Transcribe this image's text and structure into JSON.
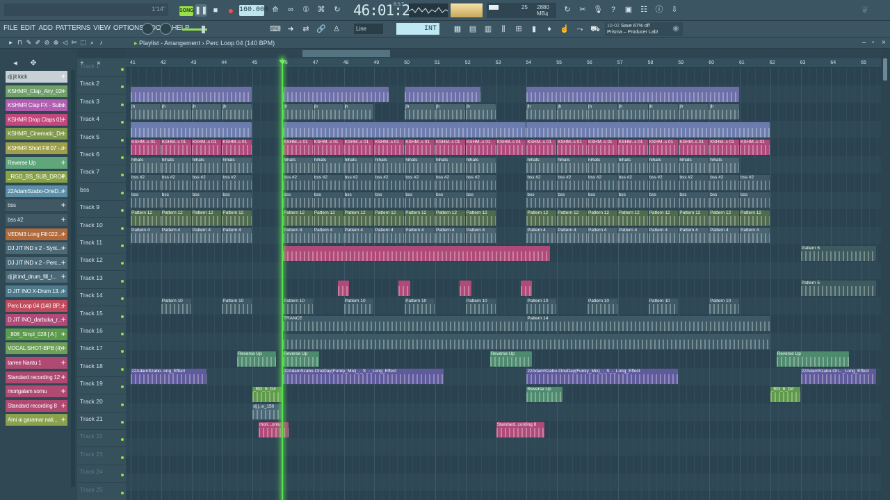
{
  "topbar": {
    "hint_time": "1'14\"",
    "song_label": "SONG",
    "play_label": "❚❚",
    "stop_label": "■",
    "rec_label": "●",
    "tempo": "160.000",
    "time": "46:01:2",
    "time_sub": "B:S:T",
    "cpu_value": "25",
    "ram_value": "2880 MB",
    "poly_value": "4"
  },
  "toolbar2": {
    "menus": [
      "FILE",
      "EDIT",
      "ADD",
      "PATTERNS",
      "VIEW",
      "OPTIONS",
      "TOOLS",
      "HELP"
    ],
    "line_mode": "Line",
    "snap_value": "INT",
    "news_date": "10-02",
    "news_headline": "Save 67% off",
    "news_body": "Prisma – Producer Lab!"
  },
  "playlist": {
    "title": "Playlist - Arrangement",
    "pattern": "Perc Loop 04 (140 BPM)",
    "bar_numbers": [
      "41",
      "42",
      "43",
      "44",
      "45",
      "46",
      "47",
      "48",
      "49",
      "50",
      "51",
      "52",
      "53",
      "54",
      "55",
      "56",
      "57",
      "58",
      "59",
      "60",
      "61",
      "62",
      "63",
      "64",
      "65"
    ]
  },
  "picker": [
    {
      "label": "dj jit kick",
      "color": "#c7d0d4",
      "text": "#22333b"
    },
    {
      "label": "KSHMR_Clap_Airy_02",
      "color": "#6fa06a",
      "text": "#ffffff"
    },
    {
      "label": "KSHMR Clap FX - Sub...",
      "color": "#b15fb0",
      "text": "#ffffff"
    },
    {
      "label": "KSHMR Drop Claps 01",
      "color": "#c2477a",
      "text": "#ffffff"
    },
    {
      "label": "KSHMR_Cinematic_Dr...",
      "color": "#7f9a4a",
      "text": "#ffffff"
    },
    {
      "label": "KSHMR Short Fill 07 -...",
      "color": "#a0a04c",
      "text": "#ffffff"
    },
    {
      "label": "Reverse Up",
      "color": "#5fa67a",
      "text": "#ffffff"
    },
    {
      "label": "_RGD_BS_SUB_DROP...",
      "color": "#87a246",
      "text": "#ffffff"
    },
    {
      "label": "22AdamSzabo-OneD...",
      "color": "#5d8fa8",
      "text": "#ffffff"
    },
    {
      "label": "bss",
      "color": "#3f5864",
      "text": "#dbe6ea"
    },
    {
      "label": "bss #2",
      "color": "#3f5864",
      "text": "#dbe6ea"
    },
    {
      "label": "VEDM3 Long Fill 022...",
      "color": "#b06a3c",
      "text": "#ffffff"
    },
    {
      "label": "DJ JIT IND x 2 - Synt...",
      "color": "#4b6876",
      "text": "#ffffff"
    },
    {
      "label": "DJ JIT IND x 2 - Perc...",
      "color": "#4b6876",
      "text": "#ffffff"
    },
    {
      "label": "dj jit ind_drum_fill_t...",
      "color": "#4b6876",
      "text": "#ffffff"
    },
    {
      "label": "D JIT INO X-Drum 13...",
      "color": "#4d7a8a",
      "text": "#ffffff"
    },
    {
      "label": "Perc Loop 04 (140 BP...",
      "color": "#c04c5e",
      "text": "#ffffff"
    },
    {
      "label": "D JIT INO_darbuka_r...",
      "color": "#b04a78",
      "text": "#ffffff"
    },
    {
      "label": "_808_Smpl_028 [ A ]",
      "color": "#5c9a4c",
      "text": "#ffffff"
    },
    {
      "label": "VOCAL SHOT-BPB (4)",
      "color": "#6ea05a",
      "text": "#ffffff"
    },
    {
      "label": "tarree Nantu 1",
      "color": "#b04a72",
      "text": "#ffffff"
    },
    {
      "label": "Standard recording 12",
      "color": "#b04a72",
      "text": "#ffffff"
    },
    {
      "label": "morigalam somu",
      "color": "#b04a72",
      "text": "#ffffff"
    },
    {
      "label": "Standard recording 8",
      "color": "#b04a72",
      "text": "#ffffff"
    },
    {
      "label": "Ami ai garamar nati...",
      "color": "#8aa14e",
      "text": "#ffffff"
    }
  ],
  "tracks": [
    "Track 1",
    "Track 2",
    "Track 3",
    "Track 4",
    "Track 5",
    "Track 6",
    "Track 7",
    "bss",
    "Track 9",
    "Track 10",
    "Track 11",
    "Track 12",
    "Track 13",
    "Track 14",
    "Track 15",
    "Track 16",
    "Track 17",
    "Track 18",
    "Track 19",
    "Track 20",
    "Track 21",
    "Track 22",
    "Track 23",
    "Track 24",
    "Track 25"
  ],
  "clips": [
    {
      "track": 1,
      "label": "",
      "color": "#6c6fa8",
      "segments": [
        [
          0,
          4
        ],
        [
          5,
          8.5
        ],
        [
          9,
          11.5
        ],
        [
          13,
          20
        ]
      ]
    },
    {
      "track": 2,
      "label": "jh",
      "color": "#4a6470",
      "segments": [
        [
          0,
          1
        ],
        [
          1,
          2
        ],
        [
          2,
          3
        ],
        [
          3,
          4
        ],
        [
          5,
          6
        ],
        [
          6,
          7
        ],
        [
          7,
          8
        ],
        [
          9,
          10
        ],
        [
          10,
          11
        ],
        [
          11,
          12
        ],
        [
          13,
          14
        ],
        [
          14,
          15
        ],
        [
          15,
          16
        ],
        [
          16,
          17
        ],
        [
          17,
          18
        ],
        [
          18,
          19
        ],
        [
          19,
          20
        ]
      ]
    },
    {
      "track": 3,
      "label": "",
      "color": "#6c7cae",
      "segments": [
        [
          0,
          4
        ],
        [
          5,
          13
        ],
        [
          13,
          21
        ]
      ]
    },
    {
      "track": 4,
      "label": "KSHM..s 01",
      "color": "#b04a7c",
      "segments": [
        [
          0,
          1
        ],
        [
          1,
          2
        ],
        [
          2,
          3
        ],
        [
          3,
          4
        ],
        [
          5,
          6
        ],
        [
          6,
          7
        ],
        [
          7,
          8
        ],
        [
          8,
          9
        ],
        [
          9,
          10
        ],
        [
          10,
          11
        ],
        [
          11,
          12
        ],
        [
          12,
          13
        ],
        [
          13,
          14
        ],
        [
          14,
          15
        ],
        [
          15,
          16
        ],
        [
          16,
          17
        ],
        [
          17,
          18
        ],
        [
          18,
          19
        ],
        [
          19,
          20
        ],
        [
          20,
          21
        ]
      ]
    },
    {
      "track": 5,
      "label": "hihats",
      "color": "#4a6470",
      "segments": [
        [
          0,
          1
        ],
        [
          1,
          2
        ],
        [
          2,
          3
        ],
        [
          3,
          4
        ],
        [
          5,
          6
        ],
        [
          6,
          7
        ],
        [
          7,
          8
        ],
        [
          8,
          9
        ],
        [
          9,
          10
        ],
        [
          10,
          11
        ],
        [
          11,
          12
        ],
        [
          13,
          14
        ],
        [
          14,
          15
        ],
        [
          15,
          16
        ],
        [
          16,
          17
        ],
        [
          17,
          18
        ],
        [
          18,
          19
        ],
        [
          19,
          20
        ]
      ]
    },
    {
      "track": 6,
      "label": "bss #2",
      "color": "#3f5a66",
      "segments": [
        [
          0,
          1
        ],
        [
          1,
          2
        ],
        [
          2,
          3
        ],
        [
          3,
          4
        ],
        [
          5,
          6
        ],
        [
          6,
          7
        ],
        [
          7,
          8
        ],
        [
          8,
          9
        ],
        [
          9,
          10
        ],
        [
          10,
          11
        ],
        [
          11,
          12
        ],
        [
          13,
          14
        ],
        [
          14,
          15
        ],
        [
          15,
          16
        ],
        [
          16,
          17
        ],
        [
          17,
          18
        ],
        [
          18,
          19
        ],
        [
          19,
          20
        ],
        [
          20,
          21
        ]
      ]
    },
    {
      "track": 7,
      "label": "bss",
      "color": "#3f5a66",
      "segments": [
        [
          0,
          1
        ],
        [
          1,
          2
        ],
        [
          2,
          3
        ],
        [
          3,
          4
        ],
        [
          5,
          6
        ],
        [
          6,
          7
        ],
        [
          7,
          8
        ],
        [
          8,
          9
        ],
        [
          9,
          10
        ],
        [
          10,
          11
        ],
        [
          11,
          12
        ],
        [
          13,
          14
        ],
        [
          14,
          15
        ],
        [
          15,
          16
        ],
        [
          16,
          17
        ],
        [
          17,
          18
        ],
        [
          18,
          19
        ],
        [
          19,
          20
        ],
        [
          20,
          21
        ]
      ]
    },
    {
      "track": 8,
      "label": "Pattern 12",
      "color": "#4f6a4c",
      "segments": [
        [
          0,
          1
        ],
        [
          1,
          2
        ],
        [
          2,
          3
        ],
        [
          3,
          4
        ],
        [
          5,
          6
        ],
        [
          6,
          7
        ],
        [
          7,
          8
        ],
        [
          8,
          9
        ],
        [
          9,
          10
        ],
        [
          10,
          11
        ],
        [
          11,
          12
        ],
        [
          13,
          14
        ],
        [
          14,
          15
        ],
        [
          15,
          16
        ],
        [
          16,
          17
        ],
        [
          17,
          18
        ],
        [
          18,
          19
        ],
        [
          19,
          20
        ],
        [
          20,
          21
        ]
      ]
    },
    {
      "track": 9,
      "label": "Pattern 4",
      "color": "#4a6472",
      "segments": [
        [
          0,
          1
        ],
        [
          1,
          2
        ],
        [
          2,
          3
        ],
        [
          3,
          4
        ],
        [
          5,
          6
        ],
        [
          6,
          7
        ],
        [
          7,
          8
        ],
        [
          8,
          9
        ],
        [
          9,
          10
        ],
        [
          10,
          11
        ],
        [
          11,
          12
        ],
        [
          13,
          14
        ],
        [
          14,
          15
        ],
        [
          15,
          16
        ],
        [
          16,
          17
        ],
        [
          17,
          18
        ],
        [
          18,
          19
        ],
        [
          19,
          20
        ],
        [
          20,
          21
        ]
      ]
    },
    {
      "track": 10,
      "label": "",
      "color": "#b04a78",
      "segments": [
        [
          5,
          13.8
        ]
      ]
    },
    {
      "track": 10,
      "label": "Pattern 6",
      "color": "#3d5a5f",
      "segments": [
        [
          22,
          24.5
        ]
      ]
    },
    {
      "track": 12,
      "label": "",
      "color": "#b04a78",
      "segments": [
        [
          6.8,
          7.2
        ],
        [
          8.8,
          9.2
        ],
        [
          10.8,
          11.2
        ],
        [
          12.8,
          13.2
        ]
      ]
    },
    {
      "track": 12,
      "label": "Pattern 5",
      "color": "#3d5a5f",
      "segments": [
        [
          22,
          24.5
        ]
      ]
    },
    {
      "track": 13,
      "label": "Pattern 10",
      "color": "#3e5a66",
      "segments": [
        [
          1,
          2
        ],
        [
          3,
          4
        ],
        [
          5,
          6
        ],
        [
          7,
          8
        ],
        [
          9,
          10
        ],
        [
          11,
          12
        ],
        [
          13,
          14
        ],
        [
          15,
          16
        ],
        [
          17,
          18
        ],
        [
          19,
          20
        ]
      ]
    },
    {
      "track": 14,
      "label": "TRANCE",
      "color": "#3e5a66",
      "segments": [
        [
          5,
          13
        ]
      ]
    },
    {
      "track": 14,
      "label": "Pattern 14",
      "color": "#3e5a66",
      "segments": [
        [
          13,
          21
        ]
      ]
    },
    {
      "track": 15,
      "label": "",
      "color": "#3e5a66",
      "segments": [
        [
          5,
          21
        ]
      ]
    },
    {
      "track": 16,
      "label": "Reverse Up",
      "color": "#4d8a6e",
      "segments": [
        [
          3.5,
          4.8
        ],
        [
          5,
          6.2
        ],
        [
          11.8,
          13.2
        ],
        [
          21.2,
          23.6
        ]
      ]
    },
    {
      "track": 17,
      "label": "22AdamSzabo..ong_Effect",
      "color": "#5f5a9c",
      "segments": [
        [
          0,
          2.5
        ]
      ]
    },
    {
      "track": 17,
      "label": "22AdamSzabo-OneDay(Funky_Mix)_-_S_-_Long_Effect",
      "color": "#5f5a9c",
      "segments": [
        [
          5,
          10.3
        ],
        [
          13,
          18
        ]
      ]
    },
    {
      "track": 17,
      "label": "22AdamSzabo-On..._Long_Effect",
      "color": "#5f5a9c",
      "segments": [
        [
          22,
          24.5
        ]
      ]
    },
    {
      "track": 18,
      "label": "_RG_6_D#",
      "color": "#5f9a4c",
      "segments": [
        [
          4,
          5
        ]
      ]
    },
    {
      "track": 18,
      "label": "Reverse Up",
      "color": "#4d8a6e",
      "segments": [
        [
          13,
          14.2
        ]
      ]
    },
    {
      "track": 18,
      "label": "_RG_6_D#",
      "color": "#5f9a4c",
      "segments": [
        [
          21,
          22
        ]
      ]
    },
    {
      "track": 19,
      "label": "dj j..e_150",
      "color": "#4b6876",
      "segments": [
        [
          4,
          5
        ]
      ]
    },
    {
      "track": 20,
      "label": "mori...omu",
      "color": "#b04a78",
      "segments": [
        [
          4.2,
          5.2
        ]
      ]
    },
    {
      "track": 20,
      "label": "Standard..cording 8",
      "color": "#b04a78",
      "segments": [
        [
          12,
          13.6
        ]
      ]
    }
  ]
}
